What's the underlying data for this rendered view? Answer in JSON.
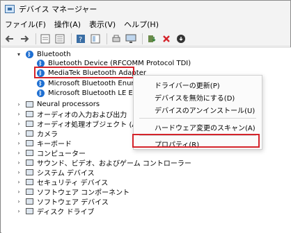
{
  "window": {
    "title": "デバイス マネージャー"
  },
  "menu": [
    "ファイル(F)",
    "操作(A)",
    "表示(V)",
    "ヘルプ(H)"
  ],
  "toolbar": {
    "icons": [
      "back-icon",
      "forward-icon",
      "properties-icon",
      "list-icon",
      "help-icon",
      "details-icon",
      "print-icon",
      "monitor-icon",
      "update-driver-icon",
      "uninstall-icon",
      "disable-icon"
    ]
  },
  "tree": {
    "bluetooth": {
      "label": "Bluetooth",
      "children": [
        "Bluetooth Device (RFCOMM Protocol TDI)",
        "MediaTek Bluetooth Adapter",
        "Microsoft Bluetooth Enumerator",
        "Microsoft Bluetooth LE Enumerator"
      ]
    },
    "categories": [
      "Neural processors",
      "オーディオの入力および出力",
      "オーディオ処理オブジェクト (APO)",
      "カメラ",
      "キーボード",
      "コンピューター",
      "サウンド、ビデオ、およびゲーム コントローラー",
      "システム デバイス",
      "セキュリティ デバイス",
      "ソフトウェア コンポーネント",
      "ソフトウェア デバイス",
      "ディスク ドライブ"
    ]
  },
  "context_menu": {
    "items": [
      "ドライバーの更新(P)",
      "デバイスを無効にする(D)",
      "デバイスのアンインストール(U)",
      "ハードウェア変更のスキャン(A)",
      "プロパティ(R)"
    ]
  },
  "colors": {
    "highlight": "#d4232a",
    "bluetooth": "#1f6fd1",
    "uninstall": "#d4232a"
  }
}
